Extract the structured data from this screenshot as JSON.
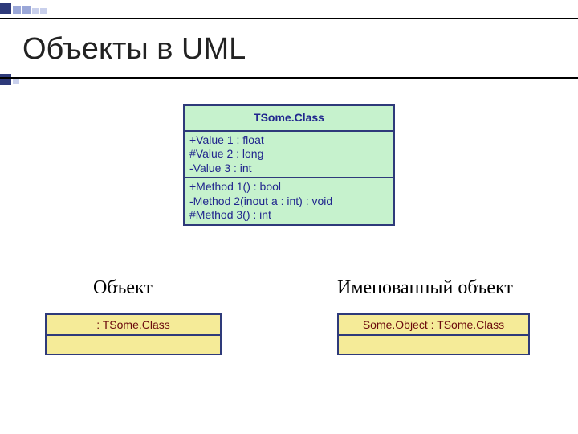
{
  "title": "Объекты в UML",
  "class_box": {
    "name": "TSome.Class",
    "attributes": [
      "+Value 1 : float",
      "#Value 2 : long",
      "-Value 3 : int"
    ],
    "methods": [
      "+Method 1() : bool",
      "-Method 2(inout a : int) : void",
      "#Method 3() : int"
    ]
  },
  "objects": {
    "anon": {
      "label": "Объект",
      "header": " : TSome.Class"
    },
    "named": {
      "label": "Именованный объект",
      "header": "Some.Object : TSome.Class"
    }
  }
}
